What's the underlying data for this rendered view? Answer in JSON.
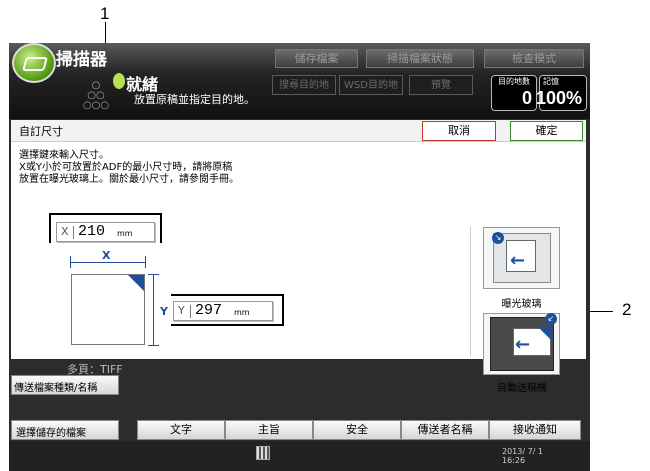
{
  "callouts": {
    "one": "1",
    "two": "2"
  },
  "header": {
    "app_title": "掃描器",
    "tabs": [
      "儲存檔案",
      "掃描檔案狀態",
      "檢查模式"
    ],
    "status_main": "就緒",
    "status_sub": "放置原稿並指定目的地。",
    "dest_buttons": [
      "搜尋目的地",
      "WSD目的地",
      "預覽"
    ],
    "dest_count_label": "目的地數",
    "dest_count": "0",
    "memory_label": "記憶",
    "memory_value": "100%"
  },
  "dialog": {
    "title": "自訂尺寸",
    "cancel_label": "取消",
    "ok_label": "確定",
    "instructions": [
      "選擇鍵來輸入尺寸。",
      "X或Y小於可放置於ADF的最小尺寸時，請將原稿",
      "放置在曝光玻璃上。關於最小尺寸，請參閱手冊。"
    ],
    "x_field": {
      "prefix": "X",
      "value": "210",
      "unit": "mm"
    },
    "y_field": {
      "prefix": "Y",
      "value": "297",
      "unit": "mm"
    },
    "x_dim_label": "X",
    "y_dim_label": "Y",
    "options": [
      {
        "label": "曝光玻璃",
        "icon": "exposure-glass-icon"
      },
      {
        "label": "自動送稿機",
        "icon": "adf-icon"
      }
    ]
  },
  "lower": {
    "file_type_value": "多頁：TIFF",
    "file_type_button": "傳送檔案種類/名稱",
    "select_stored_button": "選擇儲存的檔案",
    "bottom_buttons": [
      "文字",
      "主旨",
      "安全",
      "傳送者名稱",
      "接收通知"
    ],
    "date": "2013/ 7/ 1",
    "time": "16:26"
  },
  "colors": {
    "accent": "#1d4f9c",
    "ok_border": "#3d8a2a",
    "cancel_border": "#c0392b"
  }
}
